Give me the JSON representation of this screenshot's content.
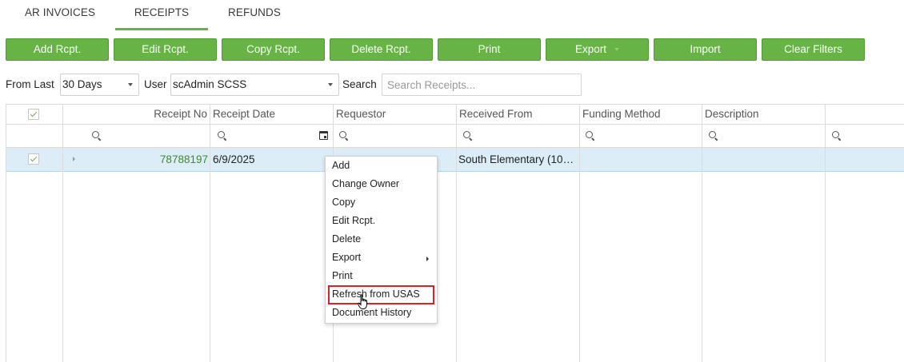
{
  "tabs": [
    {
      "label": "AR INVOICES",
      "active": false
    },
    {
      "label": "RECEIPTS",
      "active": true
    },
    {
      "label": "REFUNDS",
      "active": false
    }
  ],
  "toolbar": {
    "add": "Add Rcpt.",
    "edit": "Edit Rcpt.",
    "copy": "Copy Rcpt.",
    "delete": "Delete Rcpt.",
    "print": "Print",
    "export": "Export",
    "import": "Import",
    "clear": "Clear Filters"
  },
  "filters": {
    "from_last_label": "From Last",
    "from_last_value": "30 Days",
    "user_label": "User",
    "user_value": "scAdmin SCSS",
    "search_label": "Search",
    "search_placeholder": "Search Receipts..."
  },
  "grid": {
    "columns": [
      "Receipt No",
      "Receipt Date",
      "Requestor",
      "Received From",
      "Funding Method",
      "Description",
      ""
    ],
    "rows": [
      {
        "receipt_no": "78788197",
        "receipt_date": "6/9/2025",
        "requestor": "",
        "received_from": "South Elementary (10…",
        "funding_method": "",
        "description": "",
        "selected": true
      }
    ]
  },
  "context_menu": {
    "items": [
      "Add",
      "Change Owner",
      "Copy",
      "Edit Rcpt.",
      "Delete",
      "Export",
      "Print",
      "Refresh from USAS",
      "Document History"
    ],
    "highlighted": "Refresh from USAS"
  },
  "colors": {
    "accent": "#67b346",
    "row_selected": "#dcedf7",
    "highlight_border": "#d9212a",
    "link": "#3f8a2c"
  }
}
